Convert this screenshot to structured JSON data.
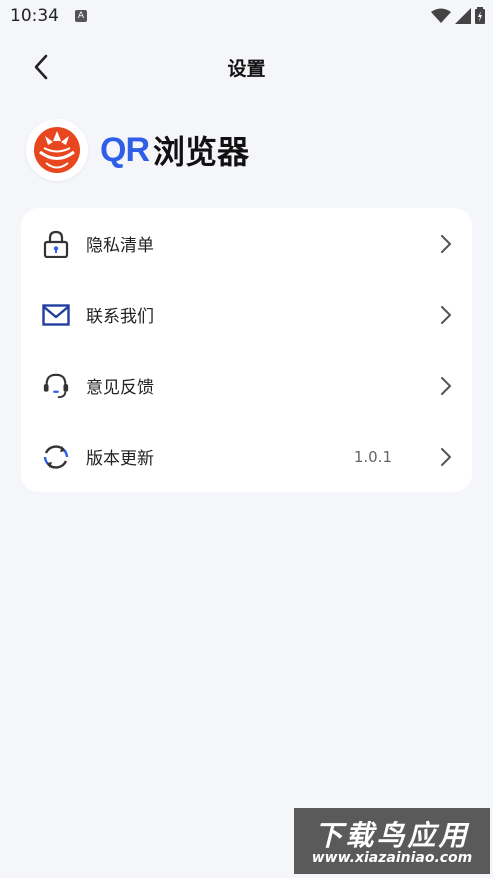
{
  "status_bar": {
    "time": "10:34",
    "notification_glyph": "A"
  },
  "header": {
    "title": "设置",
    "back_icon": "chevron-left-icon"
  },
  "brand": {
    "logo_icon": "orange-slice-logo",
    "qr_text": "QR",
    "name": "浏览器",
    "qr_color": "#2f5ee8"
  },
  "menu": {
    "items": [
      {
        "label": "隐私清单",
        "icon": "lock-icon",
        "value": ""
      },
      {
        "label": "联系我们",
        "icon": "mail-icon",
        "value": ""
      },
      {
        "label": "意见反馈",
        "icon": "headset-icon",
        "value": ""
      },
      {
        "label": "版本更新",
        "icon": "refresh-icon",
        "value": "1.0.1"
      }
    ]
  },
  "watermark": {
    "title": "下载鸟应用",
    "url": "www.xiazainiao.com"
  },
  "colors": {
    "accent": "#2f5ee8",
    "logo_orange": "#e8461e",
    "background": "#f5f6fa"
  }
}
